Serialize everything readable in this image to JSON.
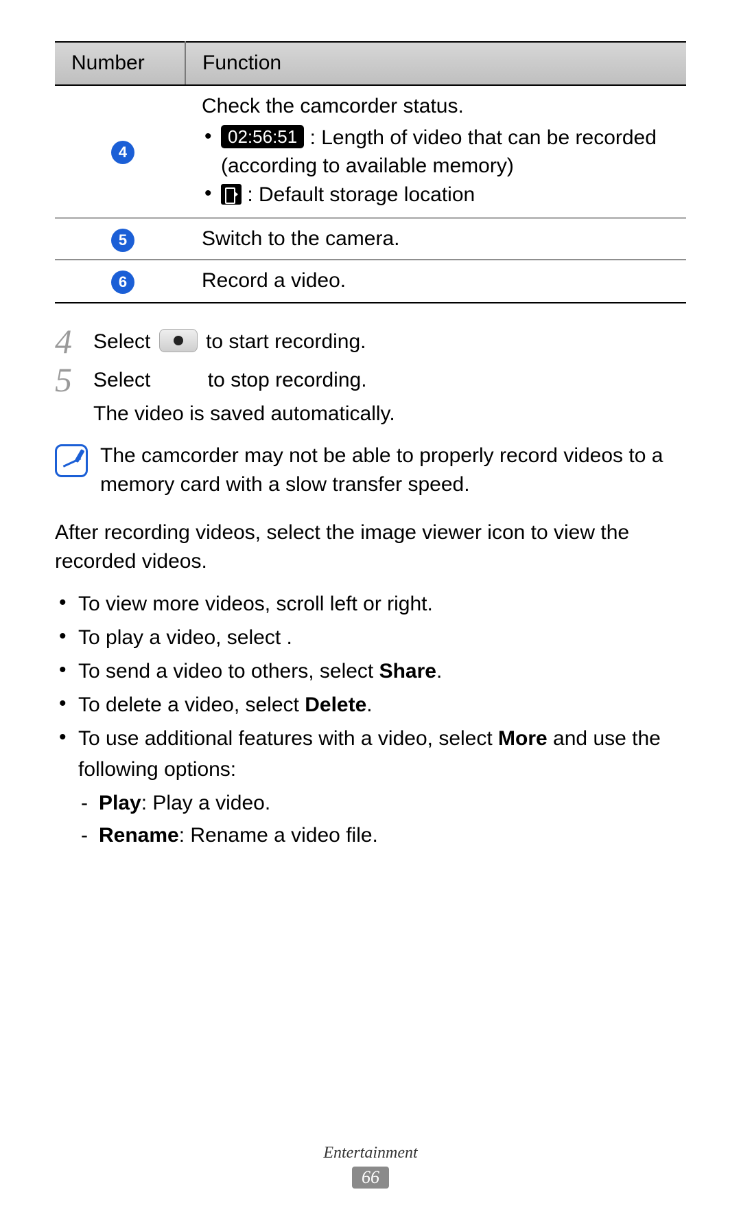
{
  "table": {
    "headers": {
      "number": "Number",
      "function": "Function"
    },
    "rows": [
      {
        "num": "4",
        "title": "Check the camcorder status.",
        "items": [
          {
            "badge": "02:56:51",
            "text": ": Length of video that can be recorded (according to available memory)"
          },
          {
            "icon": "storage",
            "text": ": Default storage location"
          }
        ]
      },
      {
        "num": "5",
        "title": "Switch to the camera."
      },
      {
        "num": "6",
        "title": "Record a video."
      }
    ]
  },
  "steps": [
    {
      "num": "4",
      "before": "Select ",
      "icon": "record",
      "after": " to start recording."
    },
    {
      "num": "5",
      "before": "Select ",
      "gap": "         ",
      "after": "to stop recording.",
      "extra": "The video is saved automatically."
    }
  ],
  "note": "The camcorder may not be able to properly record videos to a memory card with a slow transfer speed.",
  "para": "After recording videos, select the image viewer icon to view the recorded videos.",
  "bullets": [
    {
      "text": "To view more videos, scroll left or right."
    },
    {
      "prefix": "To play a video, select ",
      "suffix": " ."
    },
    {
      "prefix": "To send a video to others, select ",
      "bold": "Share",
      "suffix": "."
    },
    {
      "prefix": "To delete a video, select ",
      "bold": "Delete",
      "suffix": "."
    },
    {
      "prefix": "To use additional features with a video, select ",
      "bold": "More",
      "suffix": " and use the following options:",
      "sub": [
        {
          "bold": "Play",
          "rest": ": Play a video."
        },
        {
          "bold": "Rename",
          "rest": ": Rename a video file."
        }
      ]
    }
  ],
  "footer": {
    "section": "Entertainment",
    "page": "66"
  }
}
